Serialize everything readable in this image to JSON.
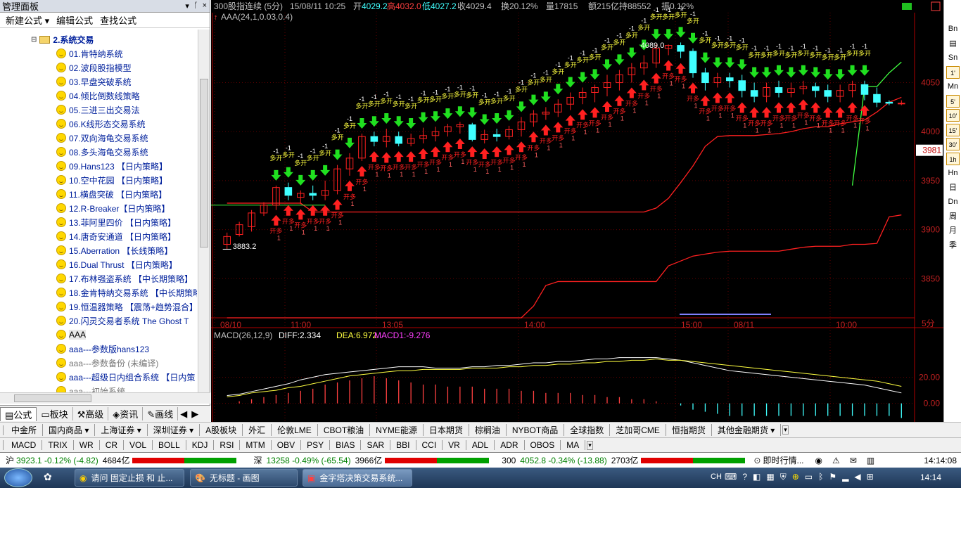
{
  "left_panel": {
    "title": "管理面板",
    "title_controls": [
      "▾",
      "ᚴ",
      "×"
    ],
    "menu": [
      "新建公式 ▾",
      "编辑公式",
      "查找公式"
    ],
    "folder_toggle": "⊟",
    "folder": "2.系统交易",
    "items": [
      "01.肯特纳系统",
      "02.波段股指模型",
      "03.早盘突破系统",
      "04.倾比倒数线策略",
      "05.三进三出交易法",
      "06.K线形态交易系统",
      "07.双向海龟交易系统",
      "08.多头海龟交易系统",
      "09.Hans123 【日内策略】",
      "10.空中花园 【日内策略】",
      "11.横盘突破 【日内策略】",
      "12.R-Breaker【日内策略】",
      "13.菲阿里四价 【日内策略】",
      "14.唐奇安通道 【日内策略】",
      "15.Aberration 【长线策略】",
      "16.Dual Thrust 【日内策略】",
      "17.布林强盗系统 【中长期策略】",
      "18.金肯特纳交易系统 【中长期策略】",
      "19.恒温器策略 【震荡+趋势混合】",
      "20.闪灵交易者系统 The Ghost T",
      "AAA",
      "aaa---参数版hans123",
      "aaa---参数备份 (未编译)",
      "aaa---超级日内组合系统 【日内策",
      "aaa---初始系统"
    ],
    "tabs": [
      "公式",
      "板块",
      "高级",
      "资讯",
      "画线"
    ],
    "tab_arrows": [
      "◀",
      "▶"
    ]
  },
  "chart": {
    "header": {
      "name": "300股指连续 (5分)",
      "date": "15/08/11 10:25",
      "open_label": "开",
      "open": "4029.2",
      "high_label": "高",
      "high": "4032.0",
      "low_label": "低",
      "low": "4027.2",
      "close": "收4029.4",
      "turnover": "换20.12%",
      "volume": "量17815",
      "amount": "额215亿",
      "oi": "持88552",
      "amp": "振0.12%"
    },
    "indicator_label": "AAA(24,1,0.03,0.4)",
    "price_ticks": [
      "4050",
      "4000",
      "3950",
      "3900",
      "3850"
    ],
    "last_price": "3981",
    "high_note": "4089.0",
    "low_note": "3883.2",
    "time_labels": [
      "08/10",
      "11:00",
      "13:05",
      "14:00",
      "15:00",
      "08/11",
      "10:00"
    ],
    "period": "5分",
    "macd": {
      "title": "MACD(26,12,9)",
      "diff": "DIFF:2.334",
      "dea": "DEA:6.972",
      "macd1": "MACD1:-9.276",
      "ticks": [
        "20.00",
        "0.00"
      ]
    },
    "sig_labels": {
      "short_open": "多开",
      "long_open": "开多",
      "minus": "-1",
      "one": "1"
    },
    "colors": {
      "up": "#ff2020",
      "down": "#40ffff",
      "buy": "#ff2020",
      "sell": "#20e020",
      "ma": "#40ff40",
      "diff": "#ffffff",
      "dea": "#ffff40",
      "label": "#ffff40"
    },
    "chart_data": {
      "type": "candlestick",
      "title": "300股指连续 (5分)",
      "ylim": [
        3810,
        4120
      ],
      "y_ticks": [
        4050,
        4000,
        3950,
        3900,
        3850
      ],
      "last_price": 3981,
      "candles": [
        [
          3885,
          3893,
          3880,
          3897
        ],
        [
          3895,
          3905,
          3893,
          3908
        ],
        [
          3903,
          3917,
          3898,
          3920
        ],
        [
          3917,
          3925,
          3914,
          3928
        ],
        [
          3925,
          3943,
          3920,
          3945
        ],
        [
          3943,
          3935,
          3930,
          3948
        ],
        [
          3933,
          3937,
          3926,
          3940
        ],
        [
          3937,
          3935,
          3930,
          3945
        ],
        [
          3935,
          3940,
          3930,
          3950
        ],
        [
          3940,
          3962,
          3936,
          3966
        ],
        [
          3962,
          3973,
          3955,
          3978
        ],
        [
          3973,
          3995,
          3970,
          3998
        ],
        [
          3995,
          3990,
          3985,
          4000
        ],
        [
          3990,
          3995,
          3984,
          4003
        ],
        [
          3995,
          3988,
          3985,
          4000
        ],
        [
          3988,
          3993,
          3985,
          3998
        ],
        [
          3993,
          3996,
          3988,
          4004
        ],
        [
          3996,
          4000,
          3990,
          4005
        ],
        [
          4000,
          4005,
          3995,
          4008
        ],
        [
          4005,
          4007,
          3998,
          4010
        ],
        [
          4007,
          3992,
          3990,
          4009
        ],
        [
          3992,
          3997,
          3988,
          4002
        ],
        [
          3997,
          3995,
          3990,
          4003
        ],
        [
          3995,
          4002,
          3992,
          4006
        ],
        [
          4002,
          4010,
          3995,
          4015
        ],
        [
          4010,
          4018,
          4005,
          4022
        ],
        [
          4018,
          4020,
          4012,
          4025
        ],
        [
          4020,
          4028,
          4015,
          4033
        ],
        [
          4028,
          4035,
          4022,
          4040
        ],
        [
          4035,
          4040,
          4028,
          4045
        ],
        [
          4040,
          4045,
          4030,
          4048
        ],
        [
          4045,
          4050,
          4036,
          4058
        ],
        [
          4050,
          4058,
          4042,
          4063
        ],
        [
          4058,
          4065,
          4050,
          4070
        ],
        [
          4065,
          4070,
          4058,
          4078
        ],
        [
          4070,
          4085,
          4065,
          4089
        ],
        [
          4085,
          4088,
          4078,
          4089
        ],
        [
          4088,
          4082,
          4075,
          4091
        ],
        [
          4082,
          4060,
          4055,
          4085
        ],
        [
          4060,
          4050,
          4042,
          4065
        ],
        [
          4050,
          4055,
          4045,
          4060
        ],
        [
          4055,
          4052,
          4045,
          4060
        ],
        [
          4052,
          4042,
          4035,
          4058
        ],
        [
          4042,
          4036,
          4030,
          4050
        ],
        [
          4036,
          4045,
          4030,
          4050
        ],
        [
          4045,
          4040,
          4035,
          4052
        ],
        [
          4040,
          4044,
          4035,
          4050
        ],
        [
          4044,
          4046,
          4038,
          4052
        ],
        [
          4046,
          4042,
          4035,
          4050
        ],
        [
          4042,
          4036,
          4030,
          4048
        ],
        [
          4036,
          4042,
          4030,
          4048
        ],
        [
          4042,
          4048,
          4035,
          4052
        ],
        [
          4048,
          4038,
          4032,
          4052
        ],
        [
          4038,
          4030,
          4025,
          4045
        ],
        [
          4030,
          4029,
          4027,
          4032
        ],
        [
          4029,
          4029,
          4027,
          4032
        ]
      ],
      "upper_band": [
        3927,
        3927,
        3927,
        3927,
        3927,
        3927,
        3927,
        3918,
        3918,
        3918,
        3918,
        3918,
        3918,
        3918,
        3918,
        3918,
        3918,
        3918,
        3918,
        3918,
        3918,
        3918,
        3918,
        3918,
        3918,
        3918,
        3918,
        3918,
        3918,
        3918,
        3918,
        3918,
        3918,
        3918,
        3918,
        3922,
        3932,
        3948,
        3965,
        3985,
        3995,
        3996,
        3996,
        3996,
        3997,
        3998,
        4000,
        4003,
        4005,
        4005,
        4008,
        4010,
        4012,
        4020,
        4030,
        4035
      ],
      "lower_band": [
        3810,
        3810,
        3810,
        3810,
        3810,
        3810,
        3810,
        3810,
        3810,
        3810,
        3810,
        3810,
        3810,
        3810,
        3810,
        3810,
        3810,
        3810,
        3810,
        3810,
        3810,
        3810,
        3810,
        3810,
        3810,
        3822,
        3843,
        3847,
        3847,
        3847,
        3847,
        3847,
        3847,
        3847,
        3847,
        3847,
        3863,
        3868,
        3873,
        3875,
        3877,
        3878,
        3878,
        3878,
        3878,
        3878,
        3880,
        3882,
        3883,
        3883,
        3883,
        3885,
        3885,
        3886,
        3913,
        3915
      ],
      "ma_line": [
        3925,
        3925,
        3925,
        3925,
        3925,
        3925,
        3925,
        3925,
        3925,
        3925,
        3925,
        3925,
        3925,
        3925,
        3925,
        3925,
        3925,
        3925,
        3925,
        3925,
        3925,
        3925,
        3925,
        3925,
        3925,
        3925,
        3925,
        3925,
        3925,
        3925,
        3925,
        3925,
        3925,
        3925,
        3925,
        3925,
        3925,
        3925,
        3925,
        3925,
        3925,
        3925,
        3925,
        3925,
        3925,
        3925,
        3925,
        3925,
        3925,
        3925,
        3925,
        3945,
        4046,
        4046,
        4060,
        4071
      ],
      "macd_diff": [
        6,
        7,
        9,
        11,
        13,
        15,
        18,
        20,
        22,
        23,
        24,
        25,
        26,
        27,
        28,
        28,
        28,
        27,
        27,
        27,
        28,
        28,
        29,
        29,
        30,
        31,
        31,
        32,
        32,
        33,
        34,
        34,
        35,
        35,
        35,
        35,
        34,
        33,
        31,
        29,
        27,
        25,
        24,
        23,
        22,
        21,
        20,
        19,
        18,
        17,
        16,
        15,
        14,
        12,
        10,
        8
      ],
      "macd_dea": [
        5,
        6,
        8,
        9,
        10,
        12,
        13,
        15,
        17,
        19,
        21,
        22,
        23,
        24,
        25,
        25,
        26,
        26,
        26,
        26,
        27,
        27,
        27,
        28,
        28,
        29,
        29,
        30,
        30,
        31,
        31,
        32,
        32,
        33,
        33,
        34,
        33,
        33,
        32,
        31,
        30,
        29,
        28,
        27,
        26,
        25,
        24,
        23,
        22,
        21,
        20,
        19,
        18,
        17,
        15,
        13
      ],
      "macd_hist": [
        0,
        1,
        2,
        3,
        4,
        5,
        6,
        7,
        9,
        10,
        11,
        12,
        13,
        12,
        11,
        10,
        9,
        9,
        8,
        8,
        8,
        7,
        7,
        7,
        6,
        6,
        5,
        5,
        5,
        4,
        4,
        3,
        3,
        2,
        2,
        1,
        0,
        -1,
        -3,
        -4,
        -5,
        -6,
        -6,
        -6,
        -6,
        -6,
        -6,
        -6,
        -6,
        -6,
        -6,
        -6,
        -6,
        -6,
        -6,
        -7
      ]
    }
  },
  "right_toolbar": [
    "Bn",
    "▤",
    "Sn",
    "1'",
    "Mn",
    "5'",
    "10'",
    "15'",
    "30'",
    "1h",
    "Hn",
    "日",
    "Dn",
    "周",
    "月",
    "季"
  ],
  "bar1": [
    "中金所",
    "国内商品 ▾",
    "上海证券 ▾",
    "深圳证券 ▾",
    "A股板块",
    "外汇",
    "伦敦LME",
    "CBOT粮油",
    "NYME能源",
    "日本期货",
    "棕榈油",
    "NYBOT商品",
    "全球指数",
    "芝加哥CME",
    "恒指期货",
    "其他金融期货 ▾"
  ],
  "bar2": [
    "MACD",
    "TRIX",
    "WR",
    "CR",
    "VOL",
    "BOLL",
    "KDJ",
    "RSI",
    "MTM",
    "OBV",
    "PSY",
    "BIAS",
    "SAR",
    "BBI",
    "CCI",
    "VR",
    "ADL",
    "ADR",
    "OBOS",
    "MA"
  ],
  "status": {
    "sh_label": "沪",
    "sh": "3923.1 -0.12% (-4.82)",
    "sh_amt": "4684亿",
    "sz_label": "深",
    "sz": "13258 -0.49% (-65.54)",
    "sz_amt": "3966亿",
    "h3_label": "300",
    "h3": "4052.8 -0.34% (-13.88)",
    "h3_amt": "2703亿",
    "quote": "即时行情...",
    "time": "14:14:08"
  },
  "taskbar": {
    "items": [
      "请问 固定止损 和 止...",
      "无标题 - 画图",
      "金字塔决策交易系统..."
    ],
    "lang": "CH",
    "clock": "14:14"
  }
}
